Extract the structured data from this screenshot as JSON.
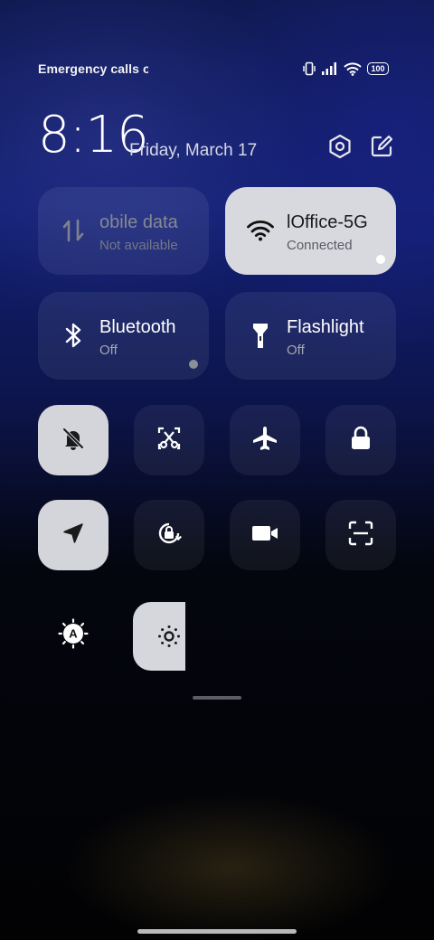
{
  "status_bar": {
    "left_text": "Emergency calls o",
    "battery": "100",
    "icons": [
      "vibrate-icon",
      "signal-icon",
      "wifi-icon",
      "battery-icon"
    ]
  },
  "header": {
    "time": "8:16",
    "date": "Friday, March 17",
    "settings_icon": "settings-hexagon-icon",
    "edit_icon": "edit-icon"
  },
  "tiles": [
    {
      "id": "mobile-data",
      "title": "obile data",
      "subtitle": "Not available",
      "icon": "mobile-data-icon",
      "active": false
    },
    {
      "id": "wifi",
      "title": "lOffice-5G",
      "subtitle": "Connected",
      "icon": "wifi-icon",
      "active": true
    },
    {
      "id": "bluetooth",
      "title": "Bluetooth",
      "subtitle": "Off",
      "icon": "bluetooth-icon",
      "active": false
    },
    {
      "id": "flashlight",
      "title": "Flashlight",
      "subtitle": "Off",
      "icon": "flashlight-icon",
      "active": false
    }
  ],
  "toggles_row1": [
    {
      "id": "silent",
      "icon": "bell-off-icon",
      "active": true
    },
    {
      "id": "screenshot",
      "icon": "screenshot-scissors-icon",
      "active": false
    },
    {
      "id": "airplane",
      "icon": "airplane-icon",
      "active": false
    },
    {
      "id": "lock-screen",
      "icon": "lock-icon",
      "active": false
    }
  ],
  "toggles_row2": [
    {
      "id": "location",
      "icon": "location-arrow-icon",
      "active": true
    },
    {
      "id": "rotation-lock",
      "icon": "rotation-lock-icon",
      "active": false
    },
    {
      "id": "screen-recorder",
      "icon": "video-camera-icon",
      "active": false
    },
    {
      "id": "scanner",
      "icon": "scan-icon",
      "active": false
    }
  ],
  "brightness": {
    "auto_icon": "auto-brightness-icon",
    "slider_icon": "brightness-sun-icon",
    "level": 0.2
  },
  "colors": {
    "active_tile": "#d8d9de",
    "inactive_tile": "rgba(255,255,255,0.07)"
  }
}
